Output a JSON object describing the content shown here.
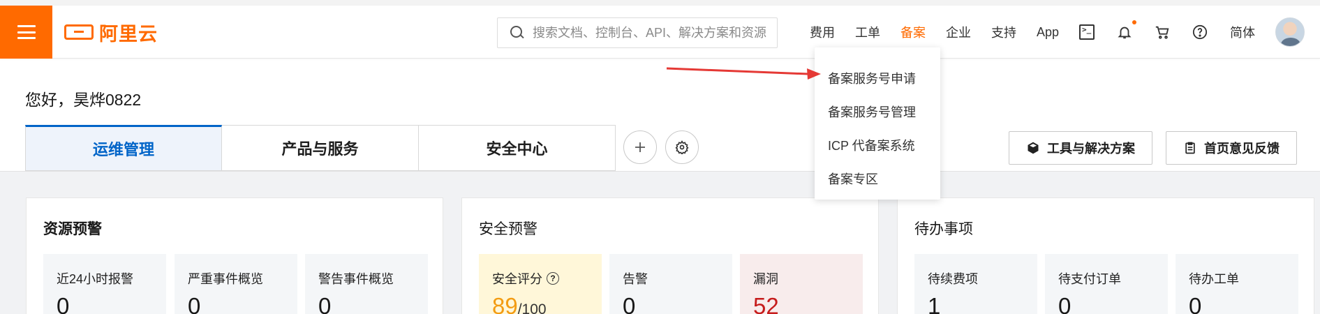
{
  "header": {
    "logo_text": "阿里云",
    "search_placeholder": "搜索文档、控制台、API、解决方案和资源",
    "nav_links": [
      "费用",
      "工单",
      "备案",
      "企业",
      "支持",
      "App"
    ],
    "active_nav": "备案",
    "language": "简体"
  },
  "colors": {
    "brand": "#ff6a00",
    "accent_blue": "#0064c8",
    "danger": "#c61c1c",
    "warning": "#f39c12"
  },
  "dropdown": {
    "items": [
      "备案服务号申请",
      "备案服务号管理",
      "ICP 代备案系统",
      "备案专区"
    ]
  },
  "greeting": "您好，昊烨0822",
  "tabs": [
    "运维管理",
    "产品与服务",
    "安全中心"
  ],
  "actions": {
    "tools": "工具与解决方案",
    "feedback": "首页意见反馈"
  },
  "cards": {
    "resource": {
      "title": "资源预警",
      "stats": [
        {
          "label": "近24小时报警",
          "value": "0"
        },
        {
          "label": "严重事件概览",
          "value": "0"
        },
        {
          "label": "警告事件概览",
          "value": "0"
        }
      ]
    },
    "security": {
      "title": "安全预警",
      "score_label": "安全评分",
      "score_value": "89",
      "score_max": "/100",
      "stats": [
        {
          "label": "告警",
          "value": "0"
        },
        {
          "label": "漏洞",
          "value": "52"
        }
      ]
    },
    "todo": {
      "title": "待办事项",
      "stats": [
        {
          "label": "待续费项",
          "value": "1"
        },
        {
          "label": "待支付订单",
          "value": "0"
        },
        {
          "label": "待办工单",
          "value": "0"
        }
      ]
    }
  }
}
